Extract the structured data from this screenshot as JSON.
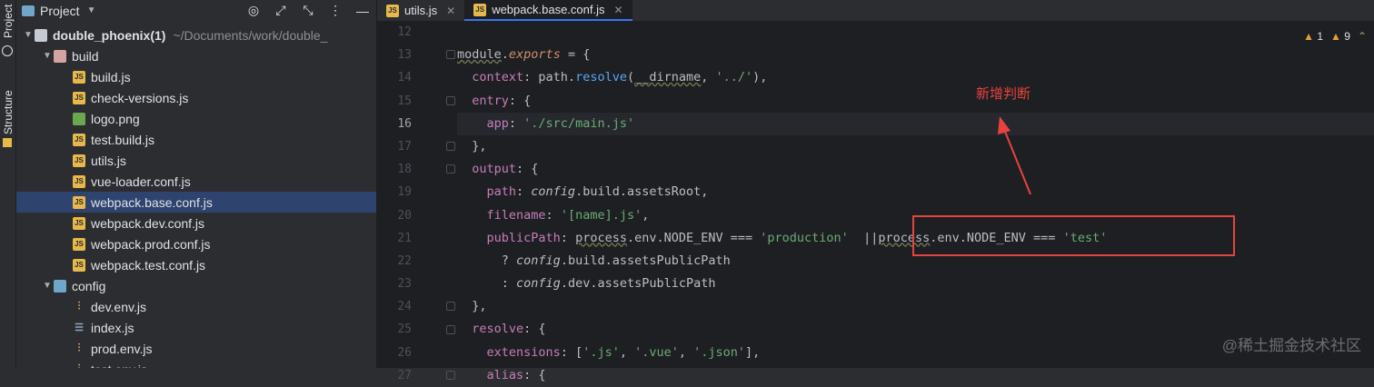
{
  "sidebar_tabs": {
    "project": "Project",
    "structure": "Structure"
  },
  "project_panel": {
    "title": "Project",
    "icons": [
      "target-icon",
      "expand-icon",
      "collapse-icon",
      "more-icon",
      "minimize-icon"
    ],
    "root": {
      "name": "double_phoenix(1)",
      "path": "~/Documents/work/double_"
    },
    "tree": [
      {
        "name": "build",
        "type": "folder-red",
        "indent": 1,
        "expanded": true
      },
      {
        "name": "build.js",
        "type": "js",
        "indent": 2
      },
      {
        "name": "check-versions.js",
        "type": "js",
        "indent": 2
      },
      {
        "name": "logo.png",
        "type": "png",
        "indent": 2
      },
      {
        "name": "test.build.js",
        "type": "js",
        "indent": 2
      },
      {
        "name": "utils.js",
        "type": "js",
        "indent": 2
      },
      {
        "name": "vue-loader.conf.js",
        "type": "js",
        "indent": 2
      },
      {
        "name": "webpack.base.conf.js",
        "type": "js",
        "indent": 2,
        "selected": true
      },
      {
        "name": "webpack.dev.conf.js",
        "type": "js",
        "indent": 2
      },
      {
        "name": "webpack.prod.conf.js",
        "type": "js",
        "indent": 2
      },
      {
        "name": "webpack.test.conf.js",
        "type": "js",
        "indent": 2
      },
      {
        "name": "config",
        "type": "folder-blue",
        "indent": 1,
        "expanded": true
      },
      {
        "name": "dev.env.js",
        "type": "env",
        "indent": 2
      },
      {
        "name": "index.js",
        "type": "idx",
        "indent": 2
      },
      {
        "name": "prod.env.js",
        "type": "env",
        "indent": 2
      },
      {
        "name": "test.env.js",
        "type": "env",
        "indent": 2
      }
    ]
  },
  "tabs": [
    {
      "label": "utils.js",
      "active": false
    },
    {
      "label": "webpack.base.conf.js",
      "active": true
    }
  ],
  "inspection": {
    "warnings": "1",
    "weak_warnings": "9"
  },
  "editor": {
    "current_line": "16",
    "lines": [
      {
        "n": "12",
        "tokens": []
      },
      {
        "n": "13",
        "tokens": [
          [
            "module",
            "dl"
          ],
          [
            ".",
            ""
          ],
          [
            "exports",
            "kw-it"
          ],
          [
            " = {",
            ""
          ]
        ]
      },
      {
        "n": "14",
        "tokens": [
          [
            "  context",
            "p"
          ],
          [
            ": path.",
            ""
          ],
          [
            "resolve",
            "fn"
          ],
          [
            "(",
            ""
          ],
          [
            "__dirname",
            "dl"
          ],
          [
            ", ",
            ""
          ],
          [
            "'../'",
            "s"
          ],
          [
            "),",
            ""
          ]
        ]
      },
      {
        "n": "15",
        "tokens": [
          [
            "  entry",
            "p"
          ],
          [
            ": {",
            ""
          ]
        ]
      },
      {
        "n": "16",
        "tokens": [
          [
            "    app",
            "p"
          ],
          [
            ": ",
            ""
          ],
          [
            "'./src/main.js'",
            "s"
          ]
        ]
      },
      {
        "n": "17",
        "tokens": [
          [
            "  },",
            ""
          ]
        ]
      },
      {
        "n": "18",
        "tokens": [
          [
            "  output",
            "p"
          ],
          [
            ": {",
            ""
          ]
        ]
      },
      {
        "n": "19",
        "tokens": [
          [
            "    path",
            "p"
          ],
          [
            ": ",
            ""
          ],
          [
            "config",
            "it"
          ],
          [
            ".build.assetsRoot,",
            ""
          ]
        ]
      },
      {
        "n": "20",
        "tokens": [
          [
            "    filename",
            "p"
          ],
          [
            ": ",
            ""
          ],
          [
            "'[name].js'",
            "s"
          ],
          [
            ",",
            ""
          ]
        ]
      },
      {
        "n": "21",
        "tokens": [
          [
            "    publicPath",
            "p"
          ],
          [
            ": ",
            ""
          ],
          [
            "process",
            "ul"
          ],
          [
            ".env.NODE_ENV === ",
            ""
          ],
          [
            "'production'",
            "s"
          ],
          [
            "  ||",
            ""
          ],
          [
            "process",
            "ul"
          ],
          [
            ".env.NODE_ENV === ",
            ""
          ],
          [
            "'test'",
            "s"
          ]
        ]
      },
      {
        "n": "22",
        "tokens": [
          [
            "      ? ",
            ""
          ],
          [
            "config",
            "it"
          ],
          [
            ".build.assetsPublicPath",
            ""
          ]
        ]
      },
      {
        "n": "23",
        "tokens": [
          [
            "      : ",
            ""
          ],
          [
            "config",
            "it"
          ],
          [
            ".dev.assetsPublicPath",
            ""
          ]
        ]
      },
      {
        "n": "24",
        "tokens": [
          [
            "  },",
            ""
          ]
        ]
      },
      {
        "n": "25",
        "tokens": [
          [
            "  resolve",
            "p"
          ],
          [
            ": {",
            ""
          ]
        ]
      },
      {
        "n": "26",
        "tokens": [
          [
            "    extensions",
            "p"
          ],
          [
            ": [",
            ""
          ],
          [
            "'.js'",
            "s"
          ],
          [
            ", ",
            ""
          ],
          [
            "'.vue'",
            "s"
          ],
          [
            ", ",
            ""
          ],
          [
            "'.json'",
            "s"
          ],
          [
            "],",
            ""
          ]
        ]
      },
      {
        "n": "27",
        "tokens": [
          [
            "    alias",
            "p"
          ],
          [
            ": {",
            ""
          ]
        ]
      }
    ]
  },
  "annotation": {
    "text": "新增判断"
  },
  "watermark": "@稀土掘金技术社区",
  "colors": {
    "accent": "#3574f0",
    "annotation": "#e6433f",
    "selection": "#2e436e"
  }
}
